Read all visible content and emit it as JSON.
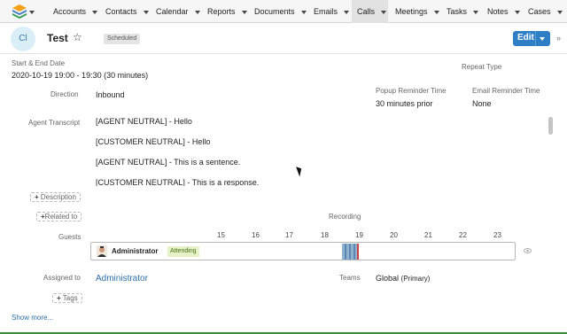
{
  "nav": {
    "items": [
      {
        "label": "Accounts"
      },
      {
        "label": "Contacts"
      },
      {
        "label": "Calendar"
      },
      {
        "label": "Reports"
      },
      {
        "label": "Documents"
      },
      {
        "label": "Emails"
      },
      {
        "label": "Calls",
        "active": true
      },
      {
        "label": "Meetings"
      },
      {
        "label": "Tasks"
      },
      {
        "label": "Notes"
      },
      {
        "label": "Cases"
      }
    ]
  },
  "record": {
    "avatar_initials": "Cl",
    "title": "Test",
    "status": "Scheduled",
    "edit_label": "Edit"
  },
  "fields": {
    "start_end_label": "Start & End Date",
    "start_end_value": "2020-10-19 19:00 - 19:30 (30 minutes)",
    "repeat_label": "Repeat Type",
    "direction_label": "Direction",
    "direction_value": "Inbound",
    "popup_label": "Popup Reminder Time",
    "popup_value": "30 minutes prior",
    "email_label": "Email Reminder Time",
    "email_value": "None",
    "transcript_label": "Agent Transcript",
    "transcript_lines": [
      "[AGENT NEUTRAL] - Hello",
      "[CUSTOMER NEUTRAL] - Hello",
      "[AGENT NEUTRAL] - This is a sentence.",
      "[CUSTOMER NEUTRAL] - This is a response."
    ],
    "description_btn": "Description",
    "related_btn": "Related to",
    "recording_label": "Recording",
    "guests_label": "Guests",
    "hours": [
      "15",
      "16",
      "17",
      "18",
      "19",
      "20",
      "21",
      "22",
      "23"
    ],
    "guest_name": "Administrator",
    "guest_status": "Attending",
    "assigned_label": "Assigned to",
    "assigned_value": "Administrator",
    "teams_label": "Teams",
    "teams_value": "Global",
    "teams_suffix": "(Primary)",
    "tags_btn": "Tags",
    "show_more": "Show more..."
  },
  "colors": {
    "accent": "#2d7ec4",
    "attending_bg": "#e6f3c9"
  }
}
